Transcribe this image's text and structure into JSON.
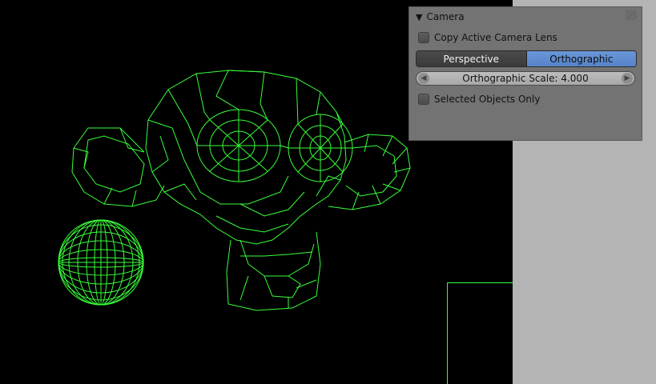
{
  "viewport": {
    "wire_color": "#39ff3a",
    "background": "#000000"
  },
  "panel": {
    "title": "Camera",
    "copy_lens_label": "Copy Active Camera Lens",
    "tabs": [
      {
        "label": "Perspective",
        "active": false
      },
      {
        "label": "Orthographic",
        "active": true
      }
    ],
    "scale_label": "Orthographic Scale: 4.000",
    "selected_only_label": "Selected Objects Only"
  },
  "icons": {
    "collapse": "triangle-down-icon",
    "grip": "grip-icon",
    "left": "arrow-left-icon",
    "right": "arrow-right-icon"
  }
}
